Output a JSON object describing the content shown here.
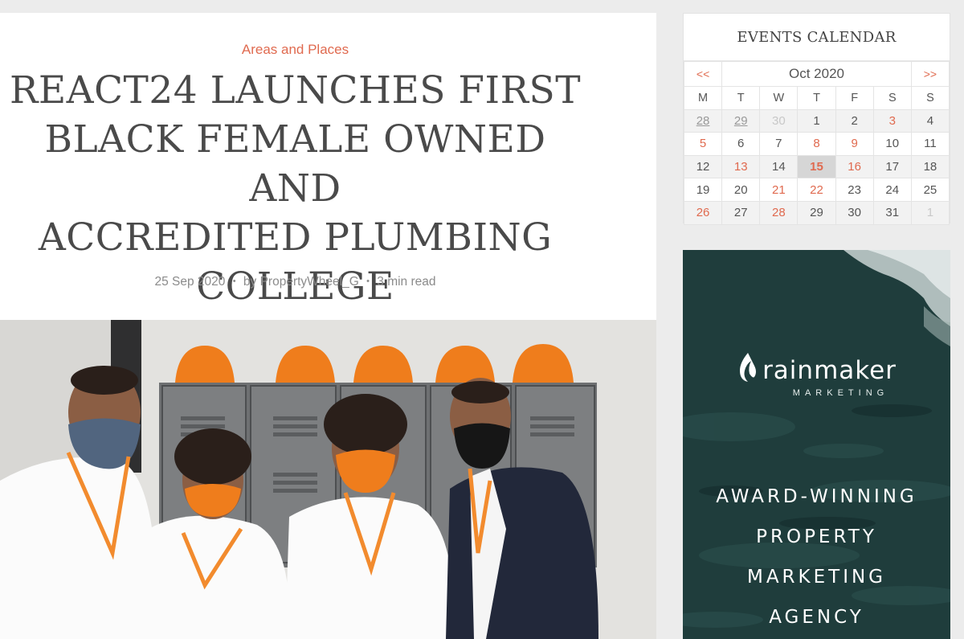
{
  "article": {
    "category": "Areas and Places",
    "title_lines": [
      "REACT24 LAUNCHES FIRST",
      "BLACK FEMALE OWNED AND",
      "ACCREDITED PLUMBING",
      "COLLEGE"
    ],
    "date": "25 Sep 2020",
    "author": "by PropertyWheel_G",
    "read_time": "3 min read",
    "separator": "•"
  },
  "calendar": {
    "title": "EVENTS CALENDAR",
    "prev": "<<",
    "next": ">>",
    "month": "Oct 2020",
    "weekdays": [
      "M",
      "T",
      "W",
      "T",
      "F",
      "S",
      "S"
    ],
    "weeks": [
      [
        "28",
        "29",
        "30",
        "1",
        "2",
        "3",
        "4"
      ],
      [
        "5",
        "6",
        "7",
        "8",
        "9",
        "10",
        "11"
      ],
      [
        "12",
        "13",
        "14",
        "15",
        "16",
        "17",
        "18"
      ],
      [
        "19",
        "20",
        "21",
        "22",
        "23",
        "24",
        "25"
      ],
      [
        "26",
        "27",
        "28",
        "29",
        "30",
        "31",
        "1"
      ]
    ],
    "accent_color": "#e06a4f"
  },
  "ad": {
    "brand": "rainmaker",
    "sub": "MARKETING",
    "tagline": [
      "AWARD-WINNING",
      "PROPERTY",
      "MARKETING",
      "AGENCY"
    ]
  }
}
